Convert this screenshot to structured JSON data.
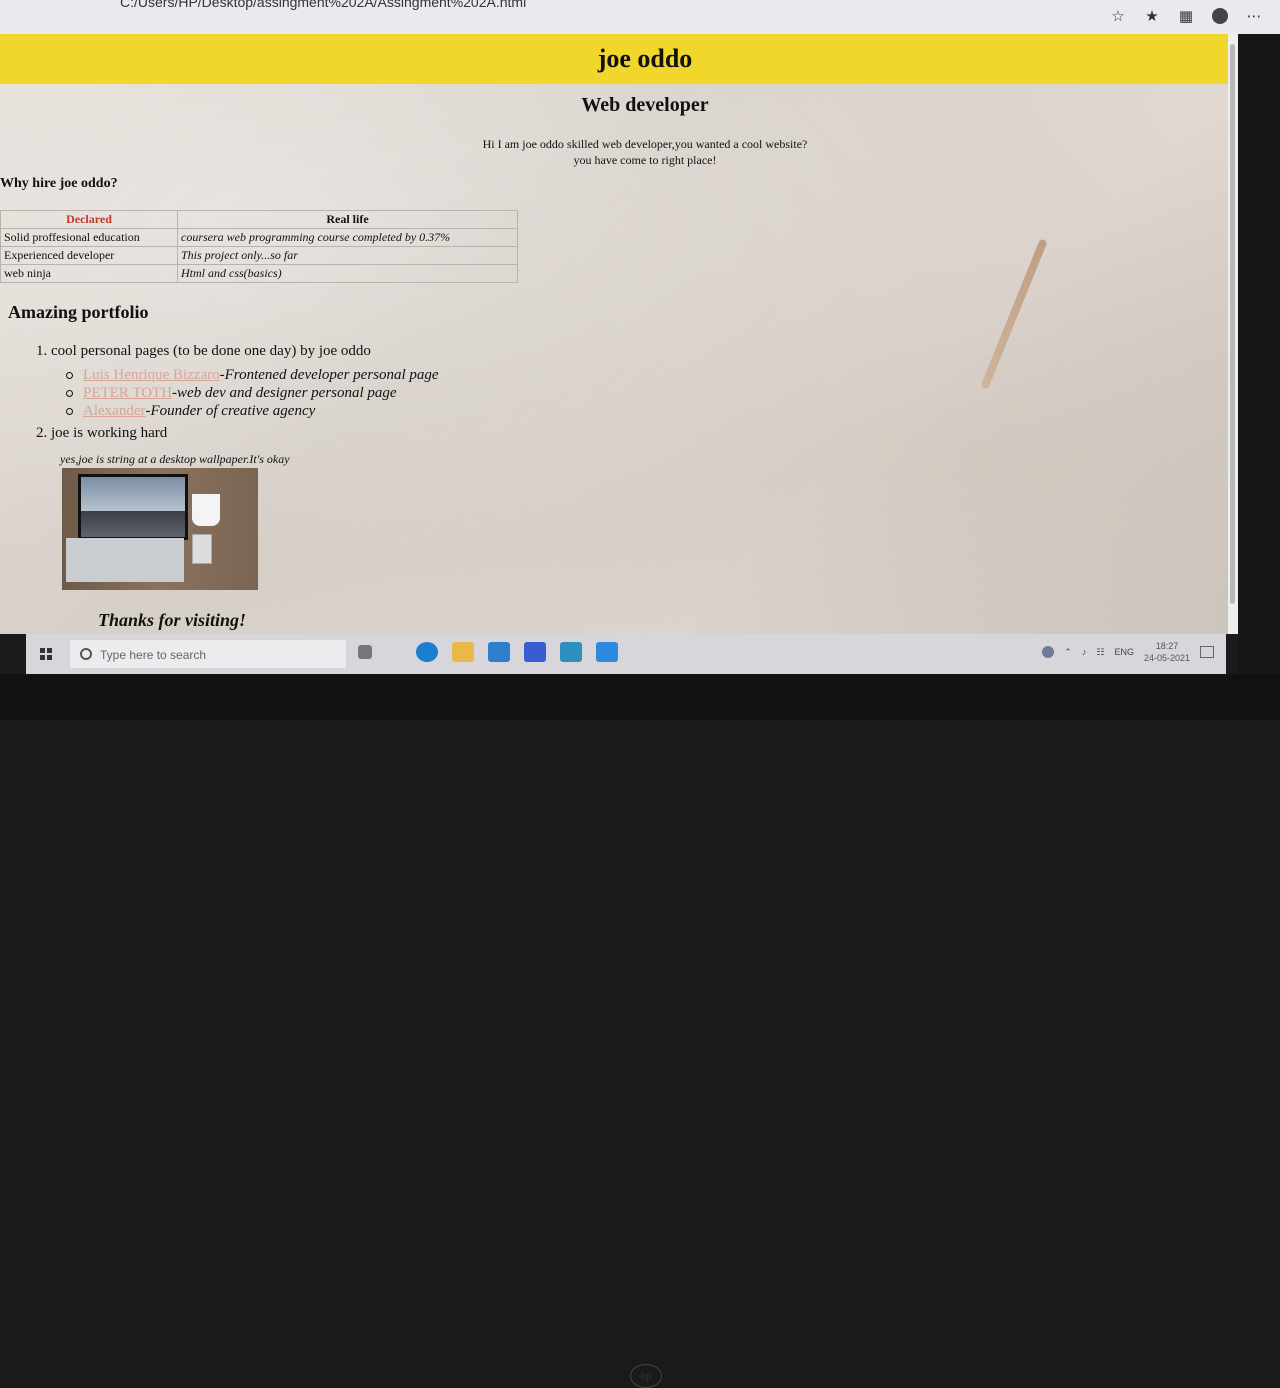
{
  "browser": {
    "address": "C:/Users/HP/Desktop/assingment%202A/Assingment%202A.html",
    "icons": [
      "reader-view-icon",
      "favorite-icon",
      "collections-icon",
      "profile-icon",
      "more-icon"
    ]
  },
  "page": {
    "title": "joe oddo",
    "subtitle": "Web developer",
    "intro_line1": "Hi I am joe oddo skilled web developer,you wanted a cool website?",
    "intro_line2": "you have come to right place!",
    "why_heading": "Why hire joe oddo?",
    "table": {
      "headers": [
        "Declared",
        "Real life"
      ],
      "rows": [
        [
          "Solid proffesional education",
          "coursera web programming course completed by 0.37%"
        ],
        [
          "Experienced developer",
          "This project only...so far"
        ],
        [
          "web ninja",
          "Html and css(basics)"
        ]
      ]
    },
    "portfolio_heading": "Amazing portfolio",
    "list": {
      "item1": "cool personal pages (to be done one day) by joe oddo",
      "num1": "1.",
      "sub": [
        {
          "link": "Luis Henrique Bizzaro",
          "desc": "-Frontened developer personal page"
        },
        {
          "link": "PETER TOTH",
          "desc": "-web dev and designer personal page"
        },
        {
          "link": "Alexander",
          "desc": "-Founder of creative agency"
        }
      ],
      "item2": "joe is working hard",
      "num2": "2."
    },
    "caption": "yes,joe is string at a desktop wallpaper.It's okay",
    "thanks": "Thanks for visiting!",
    "colors": {
      "header_band": "#f1d62c",
      "declared_header": "#c0392b",
      "link": "#d7a497"
    }
  },
  "taskbar": {
    "search_placeholder": "Type here to search",
    "language": "ENG",
    "time": "18:27",
    "date": "24-05-2021",
    "apps": [
      "task-view-icon",
      "edge-icon",
      "file-explorer-icon",
      "mail-icon",
      "dropbox-icon",
      "sublime-icon",
      "vscode-icon"
    ]
  }
}
